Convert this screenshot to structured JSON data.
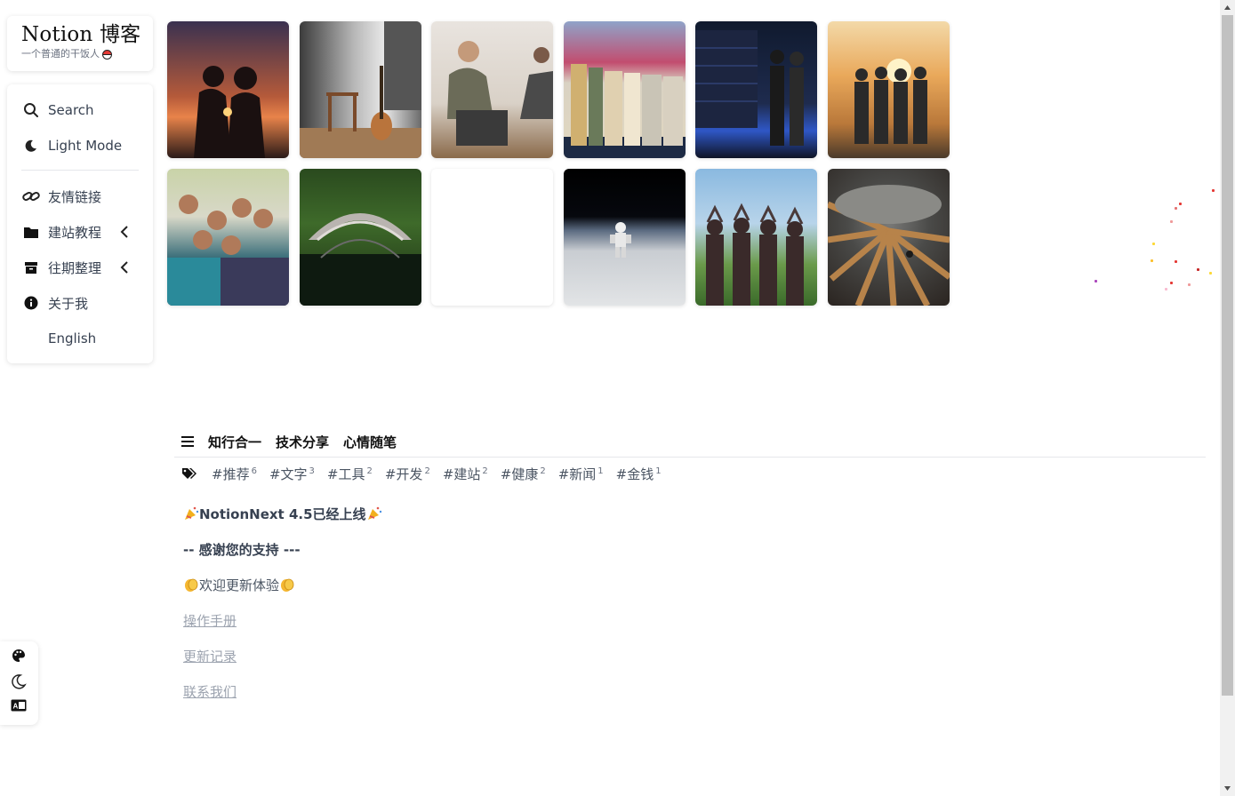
{
  "logo": {
    "title": "Notion 博客",
    "subtitle": "一个普通的干饭人"
  },
  "menu": {
    "items": [
      {
        "label": "Search",
        "icon": "search-icon"
      },
      {
        "label": "Light Mode",
        "icon": "moon-icon"
      },
      {
        "label": "友情链接",
        "icon": "link-icon"
      },
      {
        "label": "建站教程",
        "icon": "folder-icon",
        "expandable": true
      },
      {
        "label": "往期整理",
        "icon": "archive-icon",
        "expandable": true
      },
      {
        "label": "关于我",
        "icon": "info-icon"
      },
      {
        "label": "English",
        "icon": ""
      }
    ]
  },
  "gallery": {
    "images": [
      "couple-sunset-photo",
      "guitar-room-photo",
      "yoga-laptop-photo",
      "books-row-photo",
      "server-room-photo",
      "friends-sunset-photo",
      "group-selfie-photo",
      "stone-bridge-photo",
      "blank-photo",
      "astronaut-earth-photo",
      "heart-hands-photo",
      "turbine-engine-photo"
    ]
  },
  "categories": [
    "知行合一",
    "技术分享",
    "心情随笔"
  ],
  "tags": [
    {
      "name": "#推荐",
      "count": "6"
    },
    {
      "name": "#文字",
      "count": "3"
    },
    {
      "name": "#工具",
      "count": "2"
    },
    {
      "name": "#开发",
      "count": "2"
    },
    {
      "name": "#建站",
      "count": "2"
    },
    {
      "name": "#健康",
      "count": "2"
    },
    {
      "name": "#新闻",
      "count": "1"
    },
    {
      "name": "#金钱",
      "count": "1"
    }
  ],
  "announcement": {
    "headline": "NotionNext 4.5已经上线",
    "thanks": "-- 感谢您的支持 ---",
    "welcome": "欢迎更新体验",
    "links": [
      "操作手册",
      "更新记录",
      "联系我们"
    ]
  },
  "float_tools": [
    "palette-icon",
    "moon-icon",
    "translate-icon"
  ],
  "colors": {
    "accent": "#111111",
    "muted": "#9ca3af",
    "scroll_thumb": "#c1c1c1"
  }
}
